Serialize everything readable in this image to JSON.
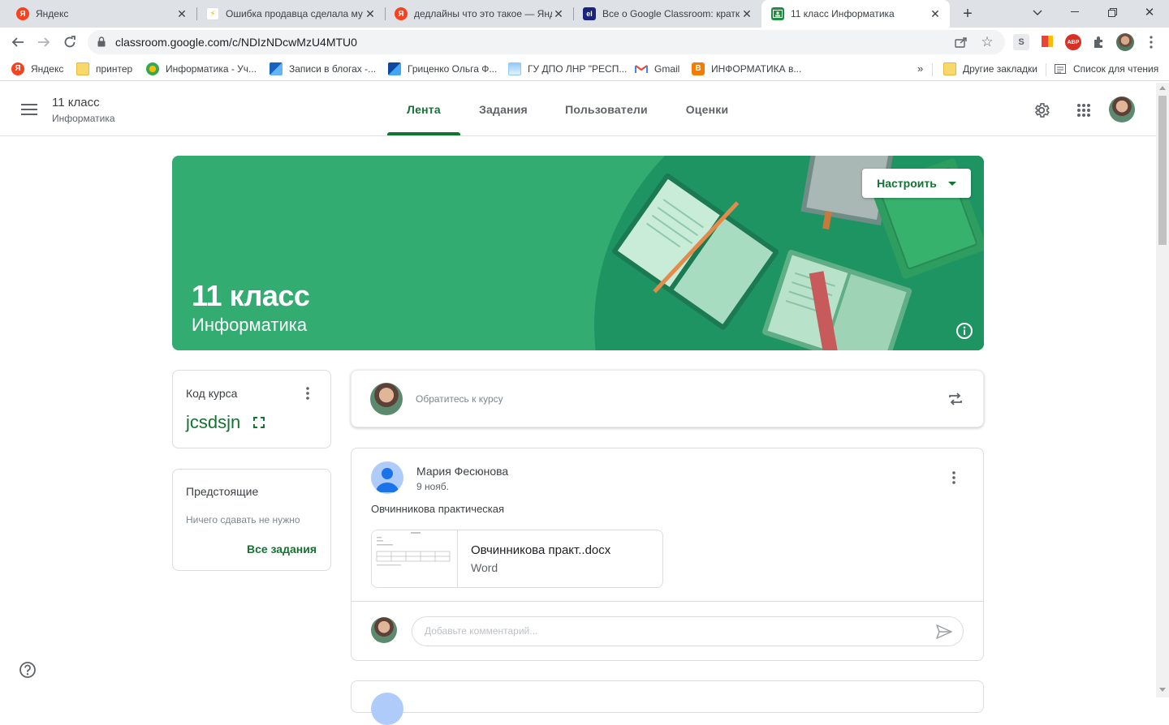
{
  "browser": {
    "tabs": [
      {
        "title": "Яндекс",
        "favicon": "yandex-icon",
        "color": "#fc3f1d"
      },
      {
        "title": "Ошибка продавца сделала му",
        "favicon": "zen-icon",
        "color": "#f5b400"
      },
      {
        "title": "дедлайны что это такое — Янд",
        "favicon": "yandex-icon",
        "color": "#fc3f1d"
      },
      {
        "title": "Все о Google Classroom: кратк",
        "favicon": "el-icon",
        "color": "#1a237e"
      },
      {
        "title": "11 класс Информатика",
        "favicon": "classroom-icon",
        "color": "#1e8e3e"
      }
    ],
    "url": "classroom.google.com/c/NDIzNDcwMzU4MTU0",
    "bookmarks": [
      "Яндекс",
      "принтер",
      "Информатика - Уч...",
      "Записи в блогах -...",
      "Гриценко Ольга Ф...",
      "ГУ ДПО ЛНР \"РЕСП...",
      "Gmail",
      "ИНФОРМАТИКА в..."
    ],
    "other_bookmarks": "Другие закладки",
    "reading_list": "Список для чтения",
    "overflow": "»",
    "extension_badge": "ABP"
  },
  "header": {
    "course_title": "11 класс",
    "course_subtitle": "Информатика",
    "tabs": [
      "Лента",
      "Задания",
      "Пользователи",
      "Оценки"
    ],
    "active_tab": 0
  },
  "banner": {
    "title": "11 класс",
    "subtitle": "Информатика",
    "customize_label": "Настроить",
    "color": "#33ac71"
  },
  "course_code": {
    "label": "Код курса",
    "code": "jcsdsjn"
  },
  "upcoming": {
    "title": "Предстоящие",
    "empty_text": "Ничего сдавать не нужно",
    "link": "Все задания"
  },
  "announce": {
    "placeholder": "Обратитесь к курсу"
  },
  "post": {
    "author": "Мария Фесюнова",
    "date": "9 нояб.",
    "text": "Овчинникова практическая",
    "attachment_name": "Овчинникова практ..docx",
    "attachment_type": "Word",
    "comment_placeholder": "Добавьте комментарий..."
  },
  "colors": {
    "accent": "#137333",
    "banner": "#33ac71"
  }
}
